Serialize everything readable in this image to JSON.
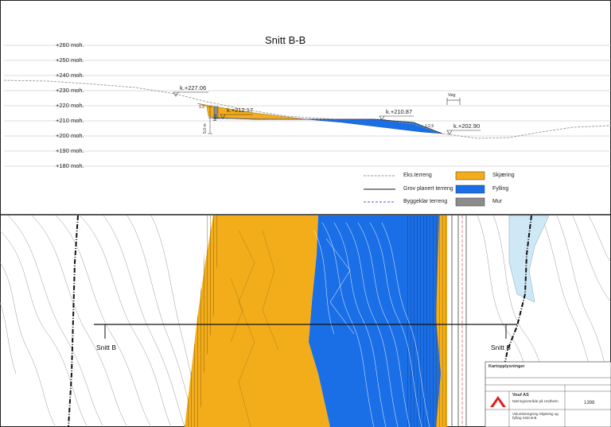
{
  "section": {
    "title": "Snitt B-B",
    "elevations": [
      "+260 moh.",
      "+250 moh.",
      "+240 moh.",
      "+230 moh.",
      "+220 moh.",
      "+210 moh.",
      "+200 moh.",
      "+190 moh.",
      "+180 moh."
    ],
    "points": [
      "k.+227.06",
      "k.+212.17",
      "k.+210.87",
      "k.+202.90"
    ],
    "small_labels": {
      "road": "Veg",
      "wall": "Mur",
      "wall_height": "5,0 m",
      "slope_left": "1:2",
      "slope_right": "1:2,5"
    }
  },
  "legend": {
    "lines": [
      "Eks.terreng",
      "Grov planert terreng",
      "Byggeklar terreng"
    ],
    "fills": [
      "Skjæring",
      "Fylling",
      "Mur"
    ]
  },
  "colors": {
    "cut": "#f4ad1a",
    "fill": "#1a6ee6",
    "wall": "#8c8c8c",
    "water": "#cfe8f5"
  },
  "plan": {
    "section_label_left": "Snitt B",
    "section_label_right": "Snitt B"
  },
  "titleblock": {
    "company": "Vouf AS",
    "project": "Næringsområde på Undheim",
    "drawing": "Volumberegning Skjæring og fylling Snitt B-B",
    "number": "1398",
    "header": "Kartopplysninger"
  }
}
